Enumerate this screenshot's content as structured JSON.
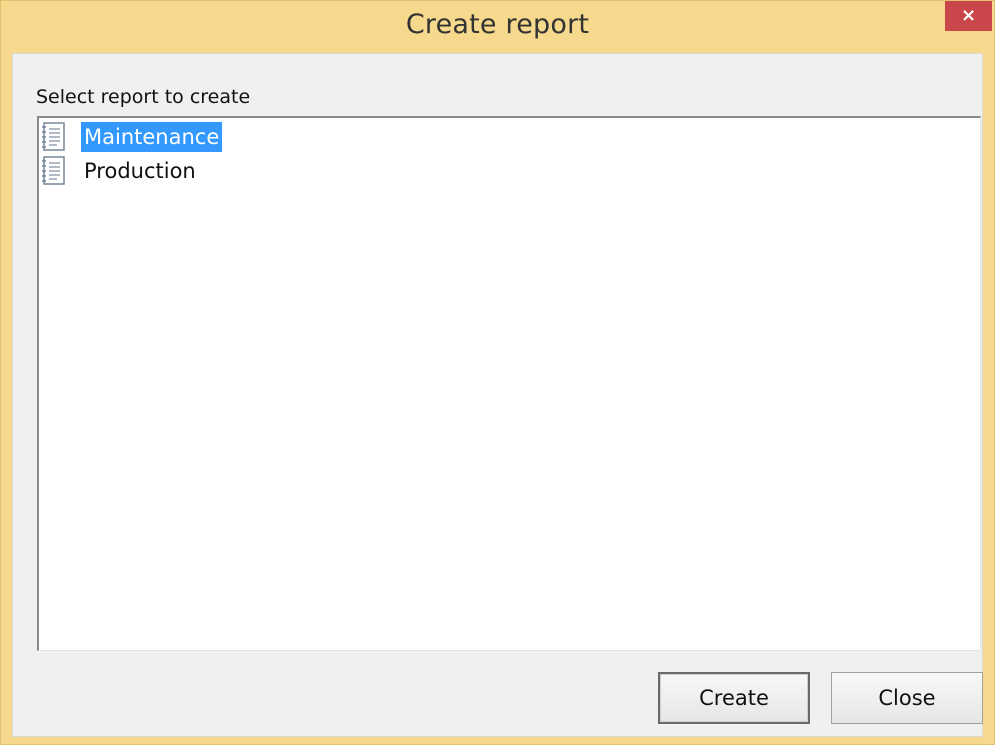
{
  "window": {
    "title": "Create report",
    "close_glyph": "×"
  },
  "dialog": {
    "prompt": "Select report to create",
    "items": [
      {
        "label": "Maintenance",
        "icon": "report-document-icon",
        "selected": true
      },
      {
        "label": "Production",
        "icon": "report-document-icon",
        "selected": false
      }
    ],
    "buttons": {
      "create_label": "Create",
      "close_label": "Close"
    }
  },
  "colors": {
    "titlebar": "#f6d98c",
    "close_button": "#c9474a",
    "selection": "#3399ff",
    "client_bg": "#f0f0f0"
  }
}
